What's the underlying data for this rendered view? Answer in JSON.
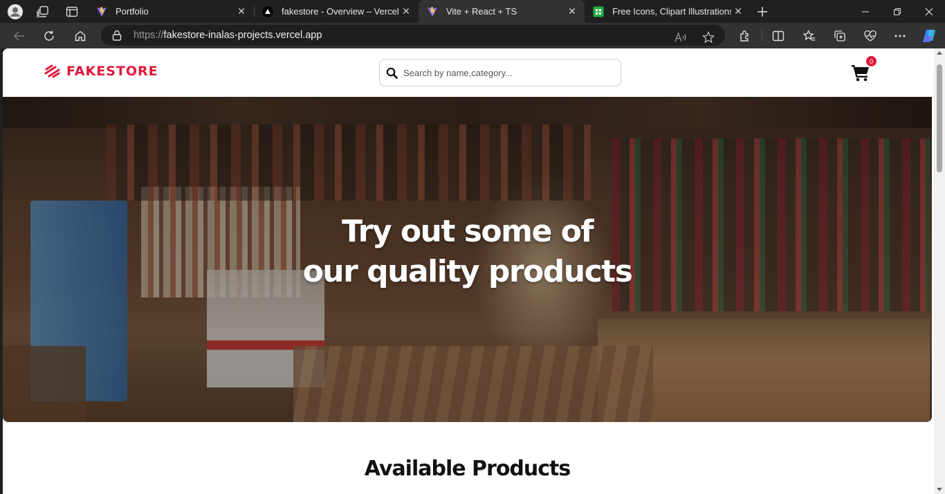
{
  "browser": {
    "tabs": [
      {
        "title": "Portfolio",
        "favicon": "vite-icon"
      },
      {
        "title": "fakestore - Overview – Vercel",
        "favicon": "vercel-icon"
      },
      {
        "title": "Vite + React + TS",
        "favicon": "vite-icon"
      },
      {
        "title": "Free Icons, Clipart Illustrations, Ph",
        "favicon": "icons8-icon"
      }
    ],
    "active_tab": 2,
    "url_prefix": "https://",
    "url_host": "fakestore-inalas-projects.vercel.app"
  },
  "site": {
    "logo_text": "FAKESTORE",
    "brand_color": "#e0183a",
    "search_placeholder": "Search by name,category...",
    "cart_count": "0",
    "hero_line1": "Try out some of",
    "hero_line2": "our quality products",
    "section_title": "Available Products"
  }
}
